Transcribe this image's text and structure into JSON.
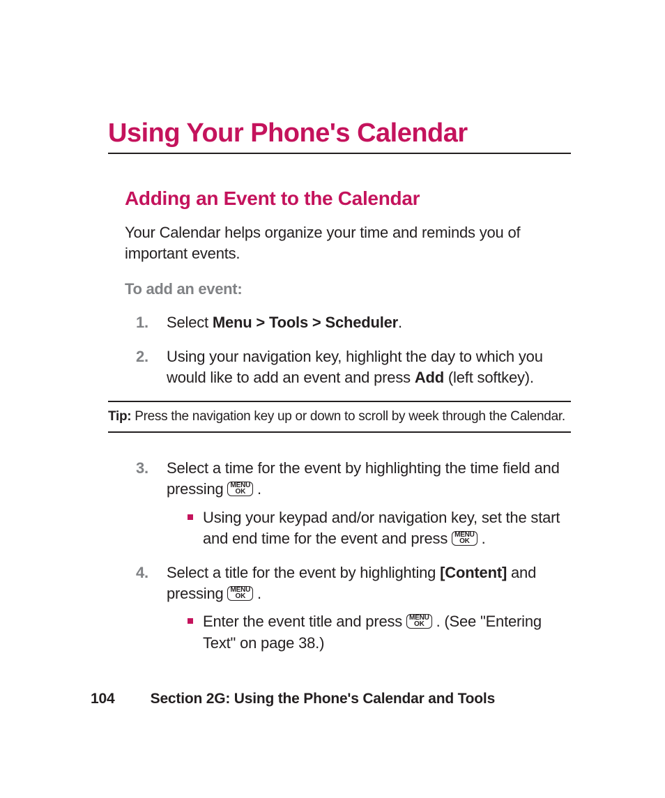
{
  "title": "Using Your Phone's Calendar",
  "subtitle": "Adding an Event to the Calendar",
  "intro": "Your Calendar helps organize your time and reminds you of important events.",
  "subhead": "To add an event:",
  "steps": {
    "s1": {
      "num": "1.",
      "pre": "Select ",
      "bold": "Menu > Tools > Scheduler",
      "post": "."
    },
    "s2": {
      "num": "2.",
      "pre": "Using your navigation key, highlight the day to which you would like to add an event and press ",
      "bold": "Add",
      "post": " (left softkey)."
    },
    "s3": {
      "num": "3.",
      "text": "Select a time for the event by highlighting the time field and pressing ",
      "tail": " ."
    },
    "s3sub": {
      "text_a": "Using your keypad and/or navigation key, set the start and end time for the event and press ",
      "tail": " ."
    },
    "s4": {
      "num": "4.",
      "pre": "Select a title for the event by highlighting ",
      "bold": "[Content]",
      "post_a": " and pressing ",
      "tail": " ."
    },
    "s4sub": {
      "text_a": "Enter the event title and press ",
      "text_b": " . (See \"Entering Text\" on page 38.)"
    }
  },
  "tip": {
    "label": "Tip:",
    "text": " Press the navigation key up or down to scroll by week through the Calendar."
  },
  "key": {
    "top": "MENU",
    "bot": "OK"
  },
  "footer": {
    "page": "104",
    "section": "Section 2G: Using the Phone's Calendar and Tools"
  }
}
